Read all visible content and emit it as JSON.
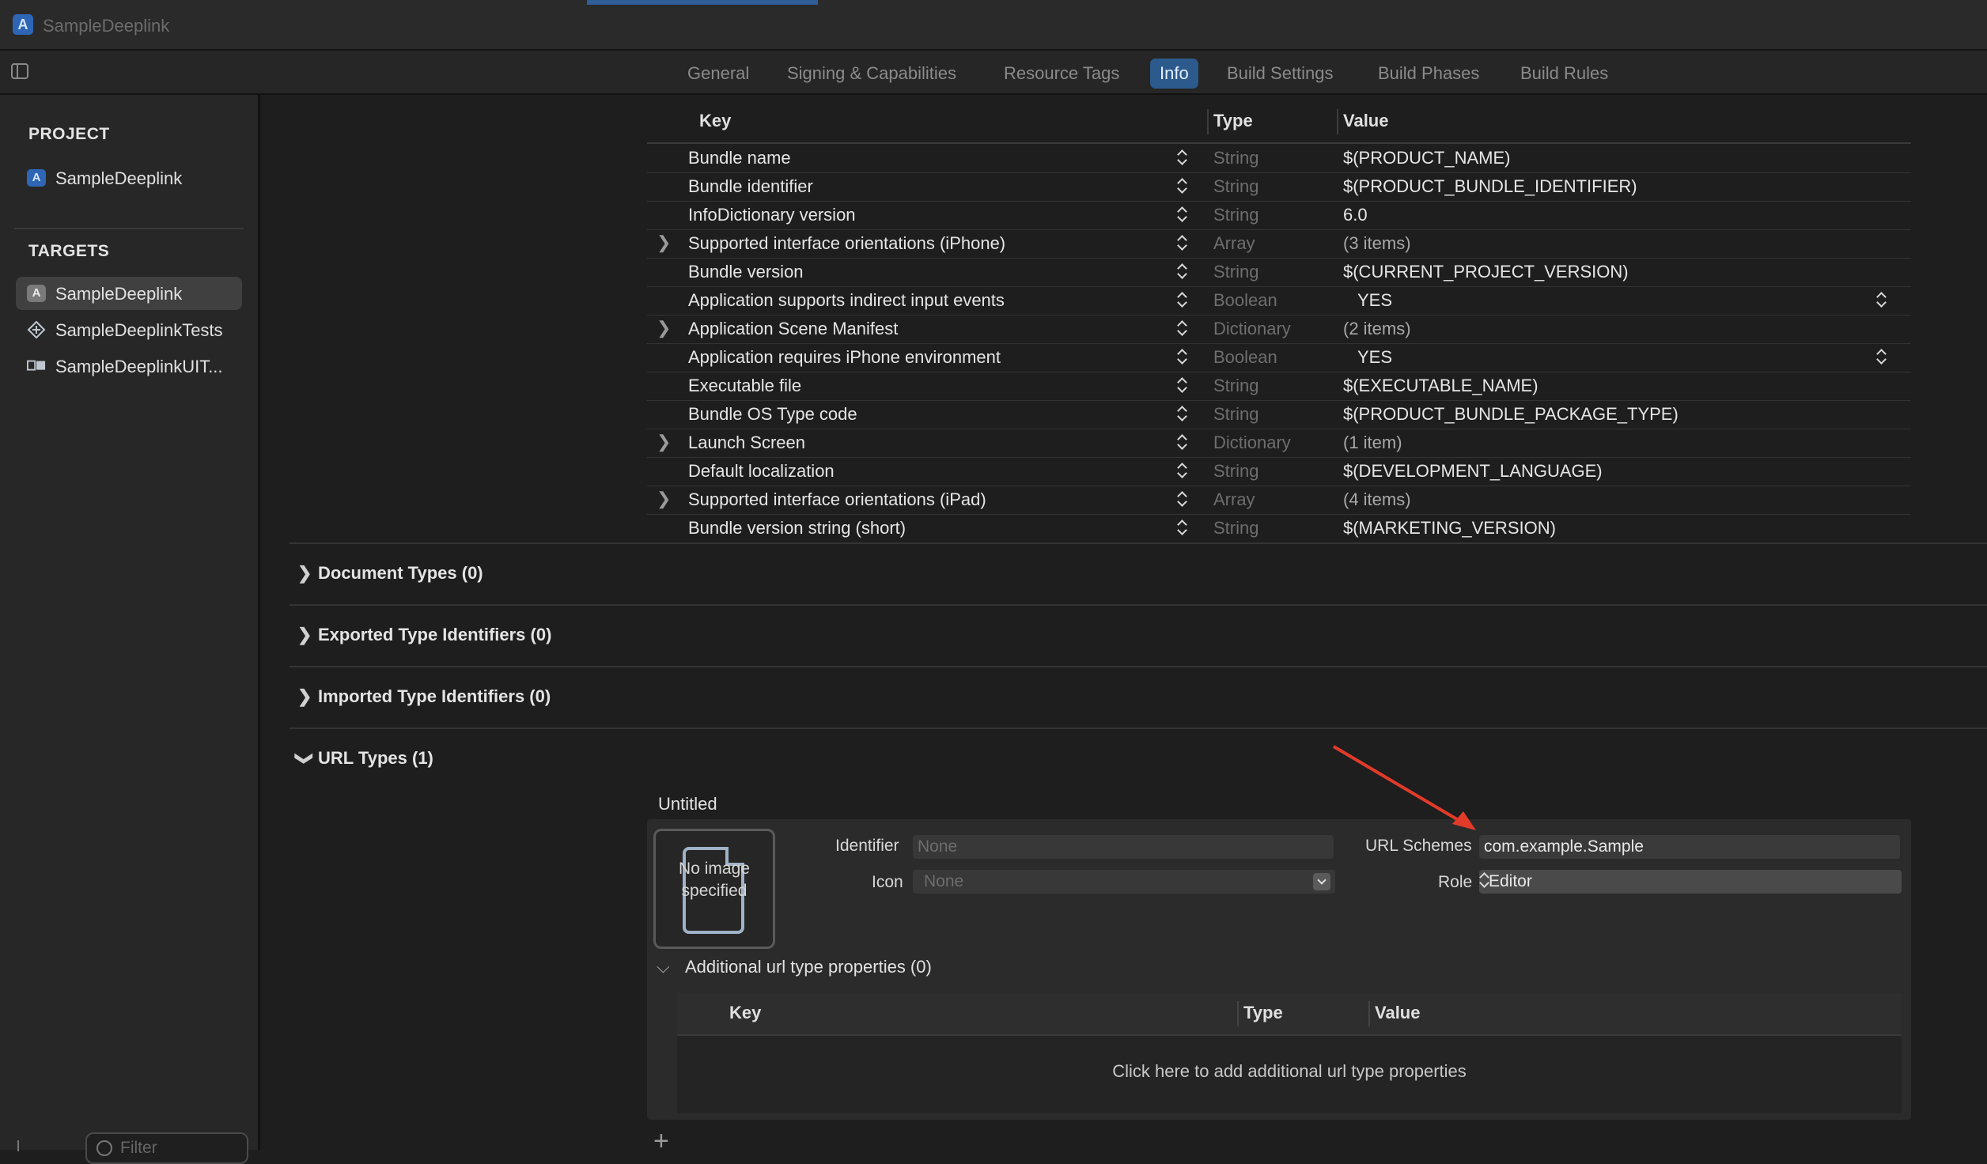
{
  "window": {
    "title": "SampleDeeplink"
  },
  "tabs": [
    "General",
    "Signing & Capabilities",
    "Resource Tags",
    "Info",
    "Build Settings",
    "Build Phases",
    "Build Rules"
  ],
  "sidebar": {
    "project_header": "PROJECT",
    "project_item": "SampleDeeplink",
    "targets_header": "TARGETS",
    "targets": [
      "SampleDeeplink",
      "SampleDeeplinkTests",
      "SampleDeeplinkUIT..."
    ],
    "filter_placeholder": "Filter"
  },
  "plist": {
    "headers": {
      "key": "Key",
      "type": "Type",
      "value": "Value"
    },
    "rows": [
      {
        "key": "Bundle name",
        "type": "String",
        "value": "$(PRODUCT_NAME)"
      },
      {
        "key": "Bundle identifier",
        "type": "String",
        "value": "$(PRODUCT_BUNDLE_IDENTIFIER)"
      },
      {
        "key": "InfoDictionary version",
        "type": "String",
        "value": "6.0"
      },
      {
        "key": "Supported interface orientations (iPhone)",
        "type": "Array",
        "value": "(3 items)"
      },
      {
        "key": "Bundle version",
        "type": "String",
        "value": "$(CURRENT_PROJECT_VERSION)"
      },
      {
        "key": "Application supports indirect input events",
        "type": "Boolean",
        "value": "YES"
      },
      {
        "key": "Application Scene Manifest",
        "type": "Dictionary",
        "value": "(2 items)"
      },
      {
        "key": "Application requires iPhone environment",
        "type": "Boolean",
        "value": "YES"
      },
      {
        "key": "Executable file",
        "type": "String",
        "value": "$(EXECUTABLE_NAME)"
      },
      {
        "key": "Bundle OS Type code",
        "type": "String",
        "value": "$(PRODUCT_BUNDLE_PACKAGE_TYPE)"
      },
      {
        "key": "Launch Screen",
        "type": "Dictionary",
        "value": "(1 item)"
      },
      {
        "key": "Default localization",
        "type": "String",
        "value": "$(DEVELOPMENT_LANGUAGE)"
      },
      {
        "key": "Supported interface orientations (iPad)",
        "type": "Array",
        "value": "(4 items)"
      },
      {
        "key": "Bundle version string (short)",
        "type": "String",
        "value": "$(MARKETING_VERSION)"
      }
    ]
  },
  "sections": {
    "document_types": "Document Types (0)",
    "exported_types": "Exported Type Identifiers (0)",
    "imported_types": "Imported Type Identifiers (0)",
    "url_types": "URL Types (1)"
  },
  "url_type": {
    "name": "Untitled",
    "image_placeholder": "No image specified",
    "identifier_label": "Identifier",
    "identifier_placeholder": "None",
    "icon_label": "Icon",
    "icon_value": "None",
    "url_schemes_label": "URL Schemes",
    "url_schemes_value": "com.example.Sample",
    "role_label": "Role",
    "role_value": "Editor",
    "additional_props": "Additional url type properties (0)",
    "sub_headers": {
      "key": "Key",
      "type": "Type",
      "value": "Value"
    },
    "empty_hint": "Click here to add additional url type properties"
  },
  "colors": {
    "accent": "#2c5a8c",
    "annotation_arrow": "#e23b2a"
  }
}
